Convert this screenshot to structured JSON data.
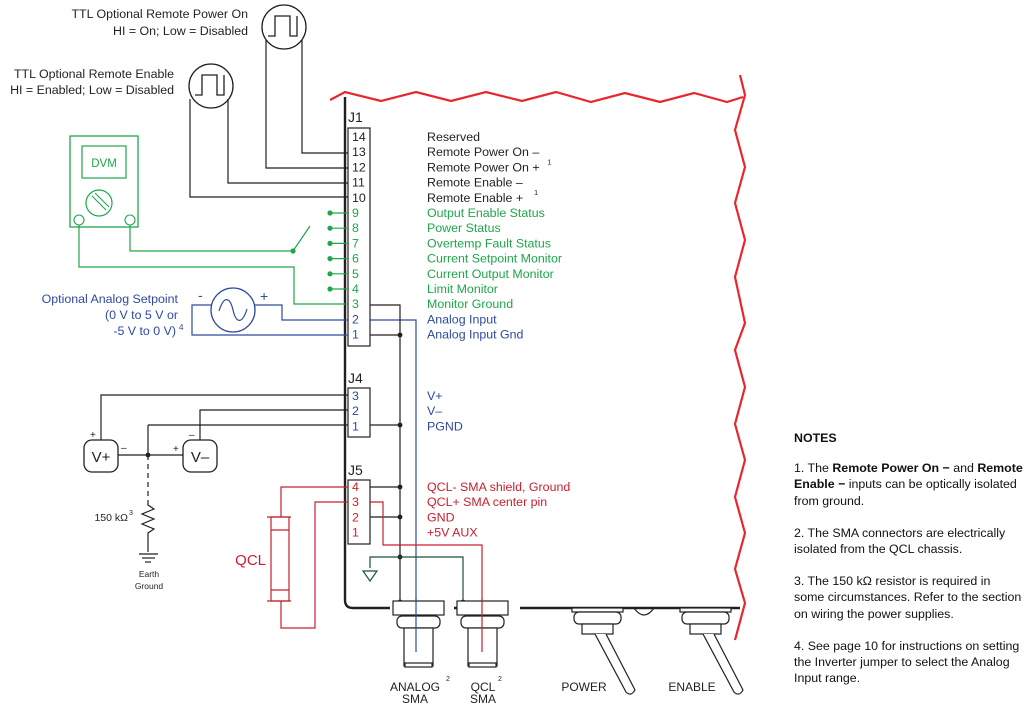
{
  "ttl_power": {
    "line1": "TTL Optional Remote Power On",
    "line2": "HI = On; Low = Disabled"
  },
  "ttl_enable": {
    "line1": "TTL Optional Remote Enable",
    "line2": "HI = Enabled; Low = Disabled"
  },
  "dvm_label": "DVM",
  "analog_setpoint": {
    "line1": "Optional Analog Setpoint",
    "line2": "(0 V to 5 V or",
    "line3": "-5 V to 0 V)",
    "note": "4",
    "minus": "-",
    "plus": "+"
  },
  "j1": {
    "label": "J1",
    "pins": [
      {
        "num": "14",
        "desc": "Reserved",
        "note": "",
        "color": "black"
      },
      {
        "num": "13",
        "desc": "Remote Power On –",
        "note": "",
        "color": "black"
      },
      {
        "num": "12",
        "desc": "Remote Power On +",
        "note": "1",
        "color": "black"
      },
      {
        "num": "11",
        "desc": "Remote Enable –",
        "note": "",
        "color": "black"
      },
      {
        "num": "10",
        "desc": "Remote Enable +",
        "note": "1",
        "color": "black"
      },
      {
        "num": "9",
        "desc": "Output Enable Status",
        "note": "",
        "color": "green"
      },
      {
        "num": "8",
        "desc": "Power Status",
        "note": "",
        "color": "green"
      },
      {
        "num": "7",
        "desc": "Overtemp Fault Status",
        "note": "",
        "color": "green"
      },
      {
        "num": "6",
        "desc": "Current Setpoint Monitor",
        "note": "",
        "color": "green"
      },
      {
        "num": "5",
        "desc": "Current Output Monitor",
        "note": "",
        "color": "green"
      },
      {
        "num": "4",
        "desc": "Limit Monitor",
        "note": "",
        "color": "green"
      },
      {
        "num": "3",
        "desc": "Monitor Ground",
        "note": "",
        "color": "green"
      },
      {
        "num": "2",
        "desc": "Analog Input",
        "note": "",
        "color": "blue"
      },
      {
        "num": "1",
        "desc": "Analog Input Gnd",
        "note": "",
        "color": "blue"
      }
    ]
  },
  "j4": {
    "label": "J4",
    "pins": [
      {
        "num": "3",
        "desc": "V+"
      },
      {
        "num": "2",
        "desc": "V–"
      },
      {
        "num": "1",
        "desc": "PGND"
      }
    ]
  },
  "j5": {
    "label": "J5",
    "pins": [
      {
        "num": "4",
        "desc": "QCL-  SMA shield, Ground"
      },
      {
        "num": "3",
        "desc": "QCL+ SMA center pin"
      },
      {
        "num": "2",
        "desc": "GND"
      },
      {
        "num": "1",
        "desc": "+5V AUX"
      }
    ]
  },
  "supplies": {
    "vplus": {
      "label": "V+",
      "plus": "+",
      "minus": "–"
    },
    "vminus": {
      "label": "V–",
      "plus": "+",
      "minus": "–"
    }
  },
  "resistor": {
    "label": "150 kΩ",
    "note": "3"
  },
  "earth_ground": {
    "line1": "Earth",
    "line2": "Ground"
  },
  "qcl_label": "QCL",
  "connectors": {
    "analog_sma": {
      "line1": "ANALOG",
      "line2": "SMA",
      "note": "2"
    },
    "qcl_sma": {
      "line1": "QCL",
      "line2": "SMA",
      "note": "2"
    },
    "power": "POWER",
    "enable": "ENABLE"
  },
  "colors": {
    "black": "#231f20",
    "green": "#1fa64a",
    "blue": "#2e4a9e",
    "red": "#c8202f",
    "border_red": "#e8262b",
    "ground_green": "#1e4d3a"
  },
  "notes": {
    "title": "NOTES",
    "n1_prefix": "1. The ",
    "n1_bold1": "Remote Power On −",
    "n1_mid": " and ",
    "n1_bold2": "Remote Enable −",
    "n1_suffix": " inputs can be optically isolated from ground.",
    "n2": "2. The SMA connectors are electrically isolated from the QCL chassis.",
    "n3": "3. The 150 kΩ resistor is required in some circumstances. Refer to the section on wiring the power supplies.",
    "n4": "4.  See page 10 for instructions on setting the Inverter jumper to select the Analog Input range."
  }
}
